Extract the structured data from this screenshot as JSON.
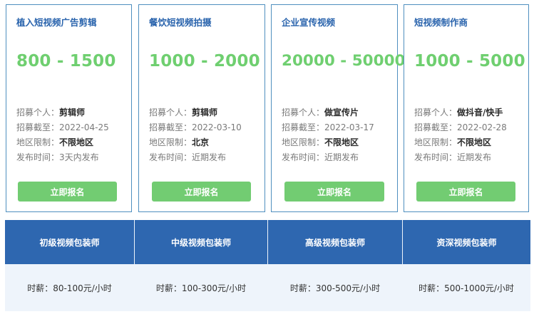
{
  "cards": [
    {
      "title": "植入短视频广告剪辑",
      "price": "800 - 1500",
      "recruit_label": "招募个人：",
      "recruit_value": "剪辑师",
      "deadline_label": "招募截至：",
      "deadline_value": "2022-04-25",
      "region_label": "地区限制：",
      "region_value": "不限地区",
      "publish_label": "发布时间：",
      "publish_value": "3天内发布",
      "button": "立即报名"
    },
    {
      "title": "餐饮短视频拍摄",
      "price": "1000 - 2000",
      "recruit_label": "招募个人：",
      "recruit_value": "剪辑师",
      "deadline_label": "招募截至：",
      "deadline_value": "2022-03-10",
      "region_label": "地区限制：",
      "region_value": "北京",
      "publish_label": "发布时间：",
      "publish_value": "近期发布",
      "button": "立即报名"
    },
    {
      "title": "企业宣传视频",
      "price": "20000 - 50000",
      "recruit_label": "招募个人：",
      "recruit_value": "做宣传片",
      "deadline_label": "招募截至：",
      "deadline_value": "2022-03-17",
      "region_label": "地区限制：",
      "region_value": "不限地区",
      "publish_label": "发布时间：",
      "publish_value": "近期发布",
      "button": "立即报名"
    },
    {
      "title": "短视频制作商",
      "price": "1000 - 5000",
      "recruit_label": "招募个人：",
      "recruit_value": "做抖音/快手",
      "deadline_label": "招募截至：",
      "deadline_value": "2022-02-28",
      "region_label": "地区限制：",
      "region_value": "不限地区",
      "publish_label": "发布时间：",
      "publish_value": "近期发布",
      "button": "立即报名"
    }
  ],
  "levels": [
    {
      "name": "初级视频包装师",
      "pay": "时薪：80-100元/小时"
    },
    {
      "name": "中级视频包装师",
      "pay": "时薪：100-300元/小时"
    },
    {
      "name": "高级视频包装师",
      "pay": "时薪：300-500元/小时"
    },
    {
      "name": "资深视频包装师",
      "pay": "时薪：500-1000元/小时"
    }
  ],
  "colors": {
    "title_blue": "#2a64ad",
    "price_green": "#6fcf70",
    "button_green": "#72cc72",
    "header_blue": "#2e67b0",
    "pay_bg": "#eef4fb"
  }
}
